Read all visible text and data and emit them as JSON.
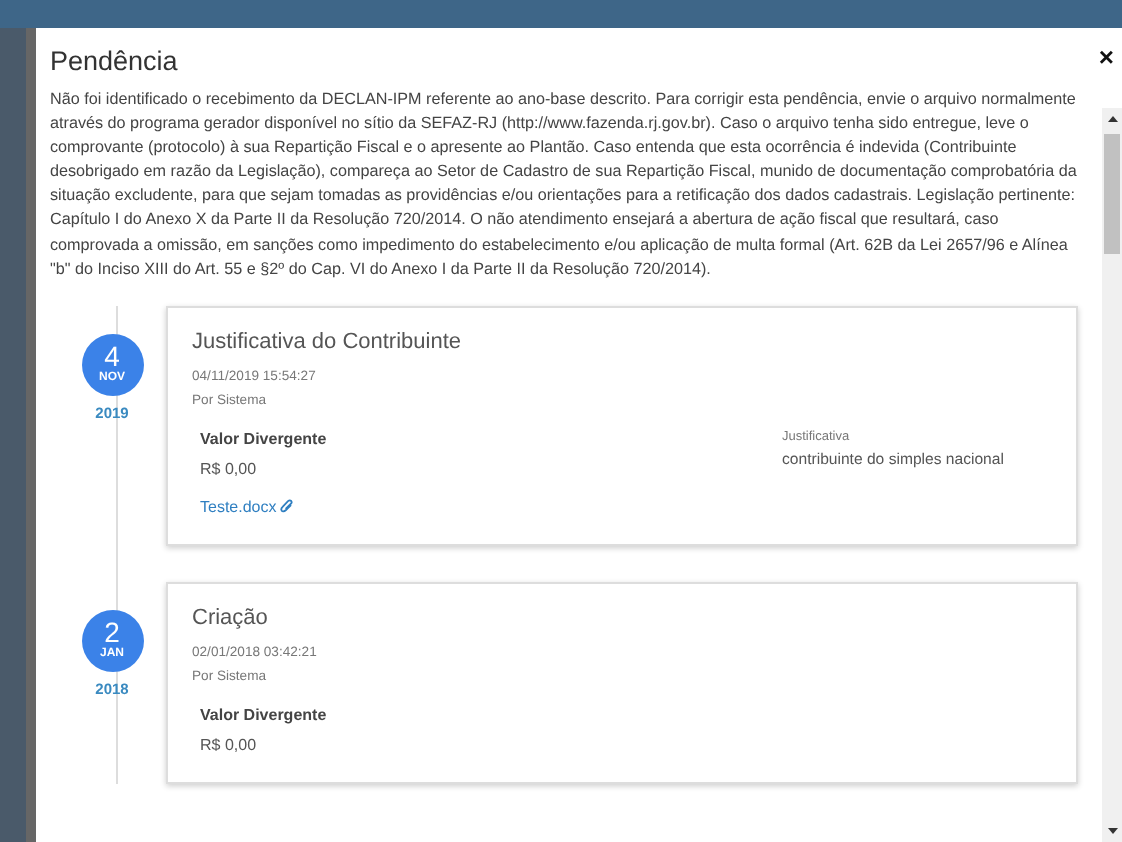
{
  "modal": {
    "title": "Pendência",
    "close": "×",
    "description": "Não foi identificado o recebimento da DECLAN-IPM referente ao ano-base descrito. Para corrigir esta pendência, envie o arquivo normalmente através do programa gerador disponível no sítio da SEFAZ-RJ (http://www.fazenda.rj.gov.br). Caso o arquivo tenha sido entregue, leve o comprovante (protocolo) à sua Repartição Fiscal e o apresente ao Plantão. Caso entenda que esta ocorrência é indevida (Contribuinte desobrigado em razão da Legislação), compareça ao Setor de Cadastro de sua Repartição Fiscal, munido de documentação comprobatória da situação excludente, para que sejam tomadas as providências e/ou orientações para a retificação dos dados cadastrais. Legislação pertinente: Capítulo I do Anexo X da Parte II da Resolução 720/2014. O não atendimento ensejará a abertura de ação fiscal que resultará, caso comprovada a omissão, em sanções como impedimento do estabelecimento e/ou aplicação de multa formal (Art. 62B da Lei 2657/96 e Alínea \"b\" do Inciso XIII do Art. 55 e §2º do Cap. VI do Anexo I da Parte II da Resolução 720/2014)."
  },
  "timeline": [
    {
      "day": "4",
      "month": "NOV",
      "year": "2019",
      "title": "Justificativa do Contribuinte",
      "datetime": "04/11/2019 15:54:27",
      "author": "Por Sistema",
      "field_label": "Valor Divergente",
      "field_value": "R$ 0,00",
      "justification_label": "Justificativa",
      "justification": "contribuinte do simples nacional",
      "attachment": "Teste.docx"
    },
    {
      "day": "2",
      "month": "JAN",
      "year": "2018",
      "title": "Criação",
      "datetime": "02/01/2018 03:42:21",
      "author": "Por Sistema",
      "field_label": "Valor Divergente",
      "field_value": "R$ 0,00"
    }
  ]
}
